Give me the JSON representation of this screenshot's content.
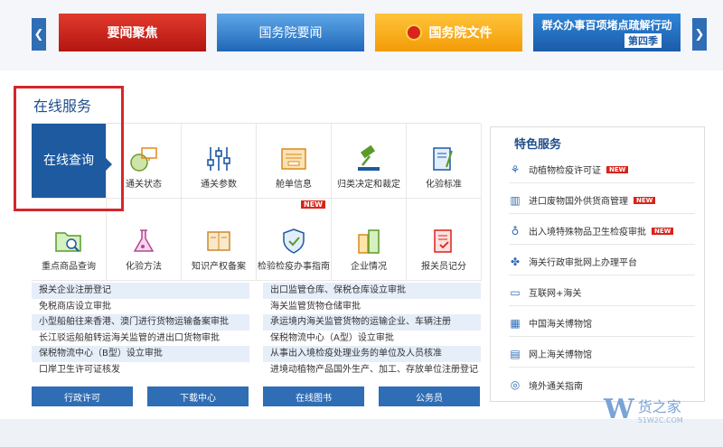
{
  "banner": {
    "prev_arrow": "❮",
    "next_arrow": "❯",
    "cards": [
      "要闻聚焦",
      "国务院要闻",
      "国务院文件",
      "群众办事百项堵点疏解行动"
    ],
    "card4_sub": "第四季"
  },
  "panel": {
    "title": "在线服务"
  },
  "tiles": [
    {
      "label": "在线查询",
      "icon": "search"
    },
    {
      "label": "通关状态",
      "icon": "globe-monitor-icon"
    },
    {
      "label": "通关参数",
      "icon": "sliders-icon"
    },
    {
      "label": "舱单信息",
      "icon": "tray-icon"
    },
    {
      "label": "归类决定和裁定",
      "icon": "gavel-icon"
    },
    {
      "label": "化验标准",
      "icon": "document-pen-icon"
    },
    {
      "label": "重点商品查询",
      "icon": "folder-search-icon"
    },
    {
      "label": "化验方法",
      "icon": "flask-icon"
    },
    {
      "label": "知识产权备案",
      "icon": "book-icon"
    },
    {
      "label": "检验检疫办事指南",
      "icon": "shield-check-icon",
      "badge": "NEW"
    },
    {
      "label": "企业情况",
      "icon": "buildings-icon"
    },
    {
      "label": "报关员记分",
      "icon": "document-check-icon"
    }
  ],
  "links_left": [
    "报关企业注册登记",
    "免税商店设立审批",
    "小型船舶往来香港、澳门进行货物运输备案审批",
    "长江驳运船舶转运海关监管的进出口货物审批",
    "保税物流中心（B型）设立审批",
    "口岸卫生许可证核发"
  ],
  "links_right": [
    "出口监管仓库、保税仓库设立审批",
    "海关监管货物仓储审批",
    "承运境内海关监管货物的运输企业、车辆注册",
    "保税物流中心（A型）设立审批",
    "从事出入境检疫处理业务的单位及人员核准",
    "进境动植物产品国外生产、加工、存放单位注册登记"
  ],
  "buttons": [
    "行政许可",
    "下载中心",
    "在线图书",
    "公务员"
  ],
  "special": {
    "title": "特色服务",
    "items": [
      {
        "label": "动植物检疫许可证",
        "new": "NEW",
        "icon": "plant-icon"
      },
      {
        "label": "进口废物国外供货商管理",
        "new": "NEW",
        "icon": "trash-icon"
      },
      {
        "label": "出入境特殊物品卫生检疫审批",
        "new": "NEW",
        "icon": "flask-icon"
      },
      {
        "label": "海关行政审批网上办理平台",
        "new": "",
        "icon": "handshake-icon"
      },
      {
        "label": "互联网+海关",
        "new": "",
        "icon": "monitor-icon"
      },
      {
        "label": "中国海关博物馆",
        "new": "",
        "icon": "museum-icon"
      },
      {
        "label": "网上海关博物馆",
        "new": "",
        "icon": "web-museum-icon"
      },
      {
        "label": "境外通关指南",
        "new": "",
        "icon": "compass-icon"
      }
    ]
  },
  "watermark": {
    "letter": "W",
    "cn": "货之家",
    "en": "51W2C.COM"
  }
}
